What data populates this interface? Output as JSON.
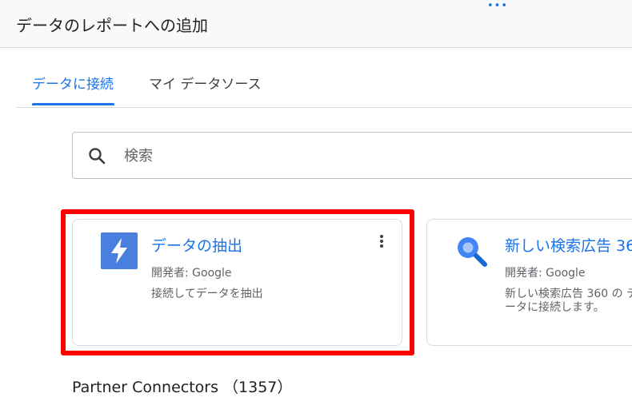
{
  "header": {
    "title": "データのレポートへの追加",
    "drag_handle": "•••"
  },
  "tabs": [
    {
      "label": "データに接続",
      "active": true
    },
    {
      "label": "マイ データソース",
      "active": false
    }
  ],
  "search": {
    "placeholder": "検索",
    "value": "",
    "icon": "search-icon"
  },
  "cards": [
    {
      "title": "データの抽出",
      "developer": "開発者: Google",
      "description": "接続してデータを抽出",
      "icon": "lightning-bolt-icon",
      "icon_color": "#4a7fe0",
      "highlighted": true
    },
    {
      "title": "新しい検索広告 36",
      "developer": "開発者: Google",
      "description": "新しい検索広告 360 の データに接続します。",
      "icon": "search-ads-360-icon",
      "icon_color": "#4285f4"
    }
  ],
  "section": {
    "title": "Partner Connectors （1357）"
  },
  "colors": {
    "accent": "#1a73e8",
    "highlight": "#ff0000"
  }
}
